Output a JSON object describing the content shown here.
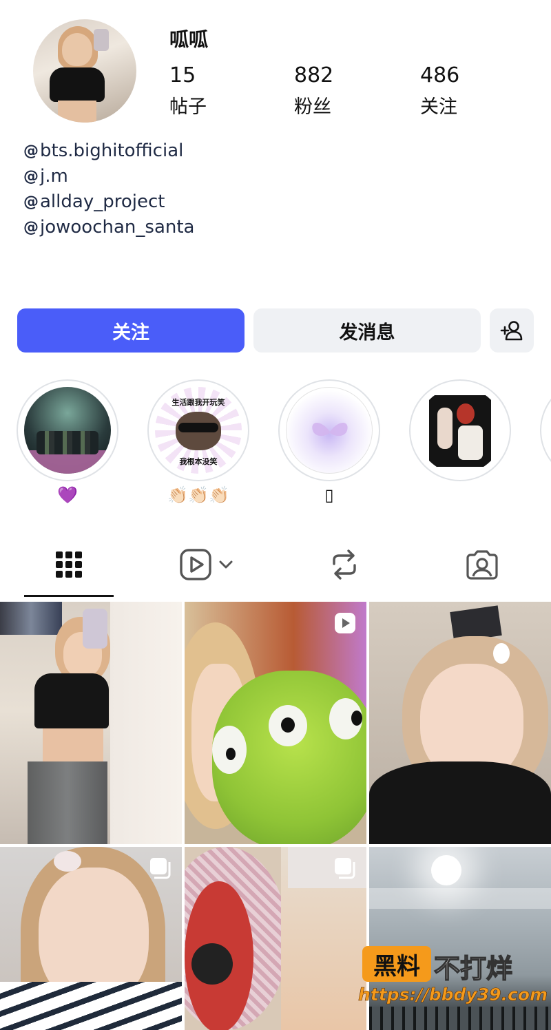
{
  "profile": {
    "username": "呱呱",
    "stats": [
      {
        "value": "15",
        "label": "帖子"
      },
      {
        "value": "882",
        "label": "粉丝"
      },
      {
        "value": "486",
        "label": "关注"
      }
    ],
    "bio_links": [
      {
        "icon": "threads-icon",
        "text": "bts.bighitofficial"
      },
      {
        "icon": "threads-icon",
        "text": "j.m"
      },
      {
        "icon": "threads-icon",
        "text": "allday_project"
      },
      {
        "icon": "threads-icon",
        "text": "jowoochan_santa"
      }
    ]
  },
  "actions": {
    "follow": "关注",
    "message": "发消息",
    "suggest_icon": "add-person-icon"
  },
  "highlights": [
    {
      "label": "💜"
    },
    {
      "label": "👏🏻👏🏻👏🏻",
      "cover_text_top": "生活跟我开玩笑",
      "cover_text_bottom": "我根本没笑"
    },
    {
      "label": "▯"
    },
    {
      "label": ""
    }
  ],
  "tabs": [
    {
      "name": "posts",
      "icon": "grid-icon",
      "active": true
    },
    {
      "name": "reels",
      "icon": "reels-icon",
      "active": false
    },
    {
      "name": "reposts",
      "icon": "repost-icon",
      "active": false
    },
    {
      "name": "tagged",
      "icon": "tagged-icon",
      "active": false
    }
  ],
  "grid": [
    {
      "type": "photo"
    },
    {
      "type": "reel",
      "badge": "reel-icon"
    },
    {
      "type": "photo"
    },
    {
      "type": "carousel",
      "badge": "carousel-icon"
    },
    {
      "type": "carousel",
      "badge": "carousel-icon"
    },
    {
      "type": "photo"
    }
  ],
  "watermark": {
    "badge": "黑料",
    "tagline": "不打烊",
    "url": "https://bbdy39.com"
  },
  "colors": {
    "primary": "#4a5df9",
    "secondary_button": "#eff1f4",
    "text": "#111111",
    "watermark_orange": "#f59a1b"
  }
}
